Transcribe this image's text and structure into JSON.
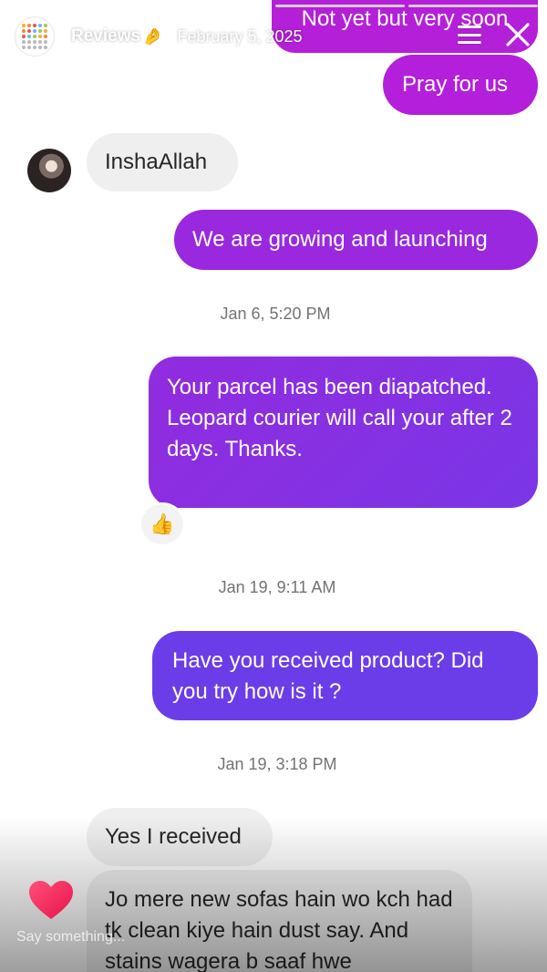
{
  "story": {
    "account_name": "Reviews",
    "name_emoji": "🤌",
    "date": "February 5, 2025",
    "segments": 4,
    "active_segments": 2
  },
  "messages": {
    "top_partial": "Not yet but very soon",
    "pray": "Pray for us",
    "inshaallah": "InshaAllah",
    "growing": "We are growing and launching",
    "ts_1": "Jan 6, 5:20 PM",
    "parcel": "Your parcel has been diapatched. Leopard courier will call your after 2 days. Thanks.",
    "reaction": "👍",
    "ts_2": "Jan 19, 9:11 AM",
    "received_q": "Have you received product? Did you try how is it ?",
    "ts_3": "Jan 19, 3:18 PM",
    "yes_received": "Yes I received",
    "jo_mere": "Jo mere new sofas hain wo kch had tk clean kiye hain dust say. And stains wagera b saaf hwe"
  },
  "reply": {
    "placeholder": "Say something..."
  },
  "colors": {
    "outgoing_magenta": "#b31fdb",
    "outgoing_purple": "#7a36e6",
    "outgoing_violet": "#6b3de9",
    "incoming_gray": "#efefef",
    "heart": "#ff2d55"
  }
}
